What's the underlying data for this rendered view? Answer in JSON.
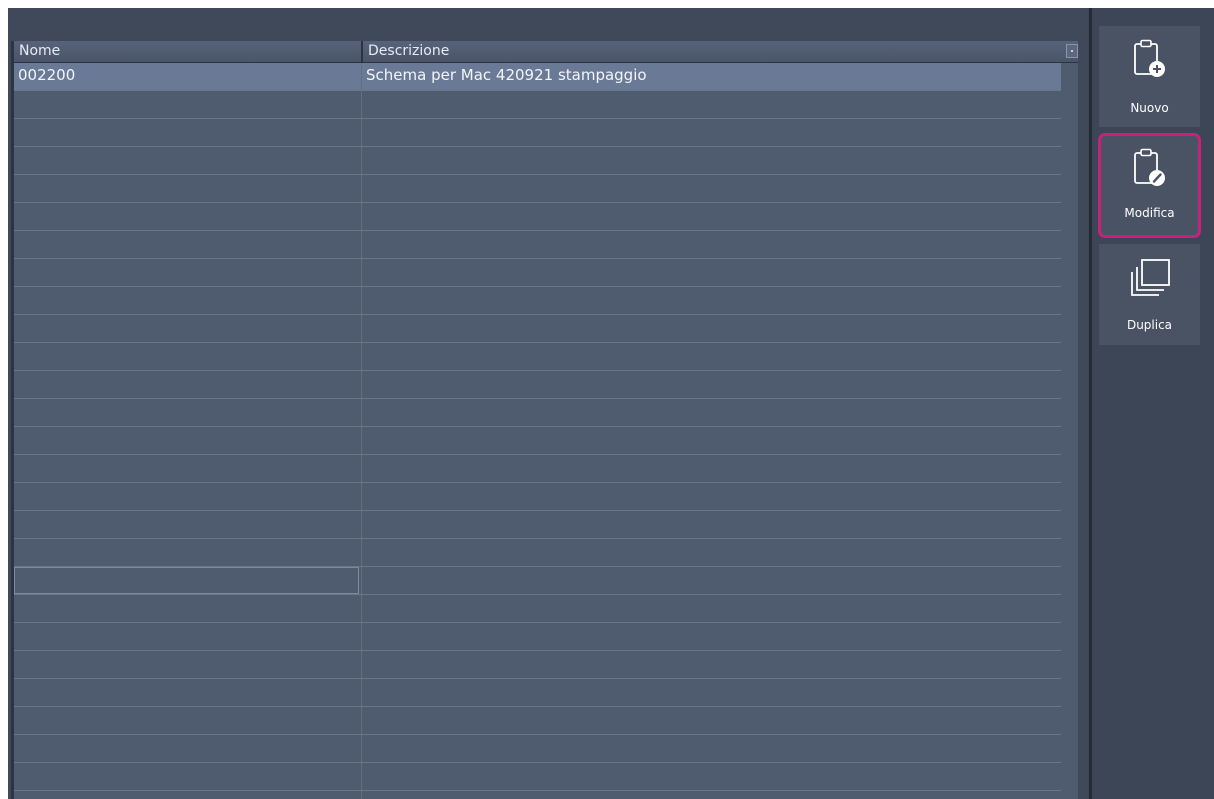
{
  "table": {
    "columns": [
      "Nome",
      "Descrizione"
    ],
    "rows": [
      {
        "nome": "002200",
        "descrizione": "Schema per Mac 420921 stampaggio"
      }
    ]
  },
  "toolbar": {
    "nuovo_label": "Nuovo",
    "modifica_label": "Modifica",
    "duplica_label": "Duplica"
  },
  "icons": {
    "nuovo": "clipboard-plus-icon",
    "modifica": "clipboard-edit-icon",
    "duplica": "duplicate-windows-icon",
    "column_menu": "column-chooser-icon"
  },
  "colors": {
    "background": "#3d4656",
    "table_background": "#4f5b6e",
    "selected_row": "#6a7a96",
    "highlight_border": "#c8217c",
    "text": "#f2f4f8"
  }
}
